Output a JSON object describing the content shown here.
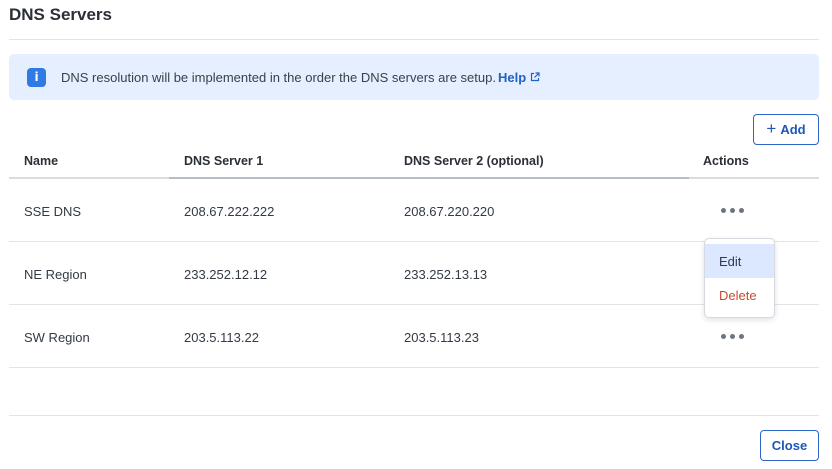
{
  "dialog": {
    "title": "DNS Servers",
    "close_label": "Close"
  },
  "banner": {
    "icon": "info-icon",
    "text": "DNS resolution will be implemented in the order the DNS servers are setup.",
    "link_label": "Help",
    "accent": "#2f7be5",
    "background": "#e6efff"
  },
  "toolbar": {
    "add_label": "Add",
    "add_icon": "+"
  },
  "table": {
    "headers": [
      "Name",
      "DNS Server 1",
      "DNS Server 2 (optional)",
      "Actions"
    ],
    "rows": [
      {
        "name": "SSE DNS",
        "dns1": "208.67.222.222",
        "dns2": "208.67.220.220"
      },
      {
        "name": "NE Region",
        "dns1": "233.252.12.12",
        "dns2": "233.252.13.13"
      },
      {
        "name": "SW Region",
        "dns1": "203.5.113.22",
        "dns2": "203.5.113.23"
      }
    ]
  },
  "action_menu": {
    "open_for_row": 0,
    "items": [
      {
        "label": "Edit",
        "highlighted": true
      },
      {
        "label": "Delete",
        "color": "#c94a34"
      }
    ]
  }
}
